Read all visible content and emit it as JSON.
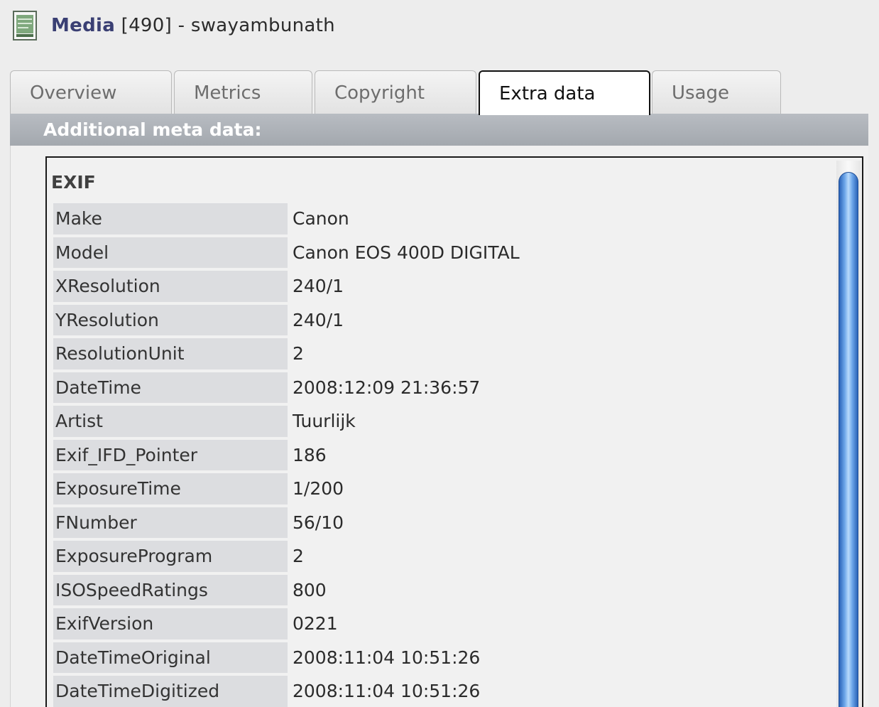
{
  "header": {
    "kind": "Media",
    "rest": " [490] - swayambunath"
  },
  "tabs": [
    {
      "label": "Overview"
    },
    {
      "label": "Metrics"
    },
    {
      "label": "Copyright"
    },
    {
      "label": "Extra data",
      "active": true
    },
    {
      "label": "Usage"
    }
  ],
  "panel": {
    "heading": "Additional meta data:",
    "section": "EXIF",
    "rows": [
      {
        "key": "Make",
        "value": "Canon"
      },
      {
        "key": "Model",
        "value": "Canon EOS 400D DIGITAL"
      },
      {
        "key": "XResolution",
        "value": "240/1"
      },
      {
        "key": "YResolution",
        "value": "240/1"
      },
      {
        "key": "ResolutionUnit",
        "value": "2"
      },
      {
        "key": "DateTime",
        "value": "2008:12:09 21:36:57"
      },
      {
        "key": "Artist",
        "value": "Tuurlijk"
      },
      {
        "key": "Exif_IFD_Pointer",
        "value": "186"
      },
      {
        "key": "ExposureTime",
        "value": "1/200"
      },
      {
        "key": "FNumber",
        "value": "56/10"
      },
      {
        "key": "ExposureProgram",
        "value": "2"
      },
      {
        "key": "ISOSpeedRatings",
        "value": "800"
      },
      {
        "key": "ExifVersion",
        "value": "0221"
      },
      {
        "key": "DateTimeOriginal",
        "value": "2008:11:04 10:51:26"
      },
      {
        "key": "DateTimeDigitized",
        "value": "2008:11:04 10:51:26"
      }
    ]
  },
  "icons": {
    "title_icon": "document-icon"
  },
  "colors": {
    "header_band": "#a8adb3",
    "scroll_thumb": "#4a8ad8",
    "kind_text": "#3a3f73"
  }
}
